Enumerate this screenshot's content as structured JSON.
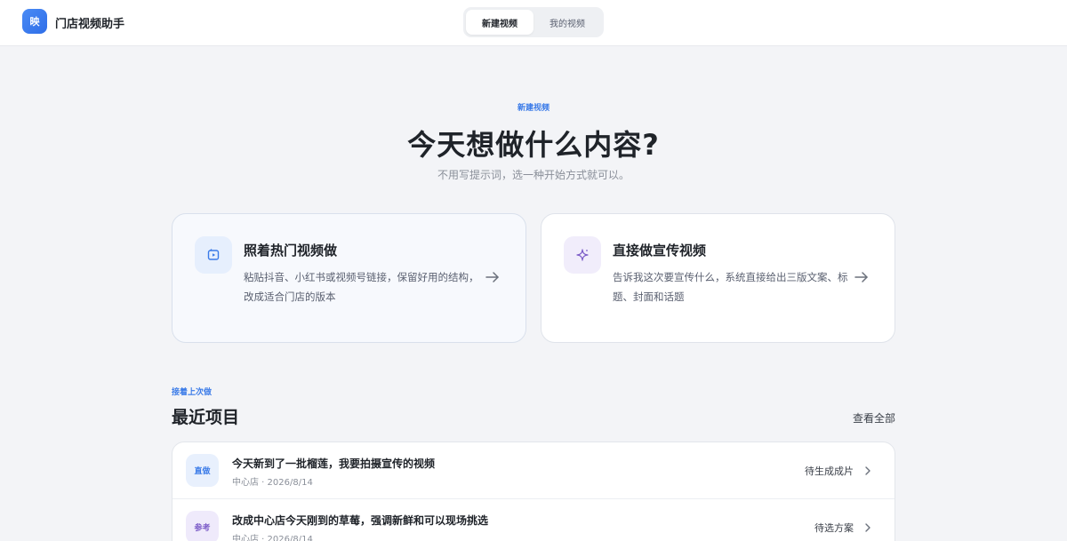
{
  "header": {
    "logo_text": "映",
    "app_title": "门店视频助手",
    "tabs": [
      {
        "label": "新建视频",
        "active": true
      },
      {
        "label": "我的视频",
        "active": false
      }
    ]
  },
  "hero": {
    "eyebrow": "新建视频",
    "title": "今天想做什么内容?",
    "subtitle": "不用写提示词，选一种开始方式就可以。"
  },
  "options": [
    {
      "icon": "video-play-icon",
      "title": "照着热门视频做",
      "description": "粘贴抖音、小红书或视频号链接，保留好用的结构，改成适合门店的版本"
    },
    {
      "icon": "sparkle-icon",
      "title": "直接做宣传视频",
      "description": "告诉我这次要宣传什么，系统直接给出三版文案、标题、封面和话题"
    }
  ],
  "recent": {
    "eyebrow": "接着上次做",
    "title": "最近项目",
    "view_all": "查看全部",
    "items": [
      {
        "tag": "直做",
        "title": "今天新到了一批榴莲，我要拍摄宣传的视频",
        "meta": "中心店 · 2026/8/14",
        "status": "待生成成片"
      },
      {
        "tag": "参考",
        "title": "改成中心店今天刚到的草莓，强调新鲜和可以现场挑选",
        "meta": "中心店 · 2026/8/14",
        "status": "待选方案"
      }
    ]
  },
  "colors": {
    "accent": "#3b7be8",
    "purple_accent": "#7c5cc8",
    "background": "#f3f4f7"
  }
}
